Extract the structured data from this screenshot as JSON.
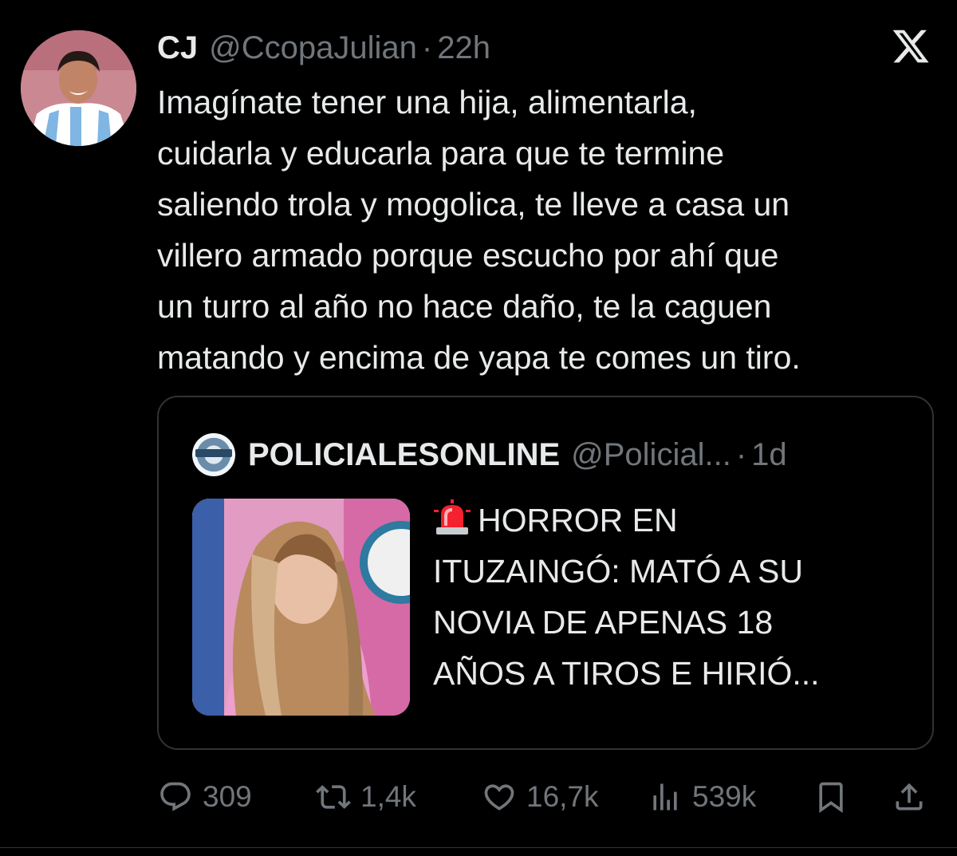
{
  "tweet": {
    "display_name": "CJ",
    "handle": "@CcopaJulian",
    "separator": "·",
    "time": "22h",
    "text": "Imagínate tener una hija, alimentarla,\ncuidarla y educarla para que te termine\nsaliendo trola y mogolica, te lleve a casa un\nvillero armado porque escucho por ahí que\nun turro al año no hace daño, te la caguen\nmatando y encima de yapa te comes un tiro."
  },
  "quote": {
    "display_name": "POLICIALESONLINE",
    "handle": "@Policial...",
    "separator": "·",
    "time": "1d",
    "text": "HORROR EN\nITUZAINGÓ: MATÓ A SU\nNOVIA DE APENAS 18\nAÑOS A TIROS E HIRIÓ..."
  },
  "actions": {
    "replies": "309",
    "retweets": "1,4k",
    "likes": "16,7k",
    "views": "539k"
  },
  "icons": {
    "logo": "x-logo-icon",
    "reply": "reply-icon",
    "retweet": "retweet-icon",
    "like": "heart-icon",
    "views": "views-icon",
    "bookmark": "bookmark-icon",
    "share": "share-icon",
    "siren": "siren-icon"
  },
  "colors": {
    "background": "#000000",
    "text": "#e7e9ea",
    "muted": "#71767b",
    "border": "#2f3336",
    "siren": "#f4212e"
  }
}
